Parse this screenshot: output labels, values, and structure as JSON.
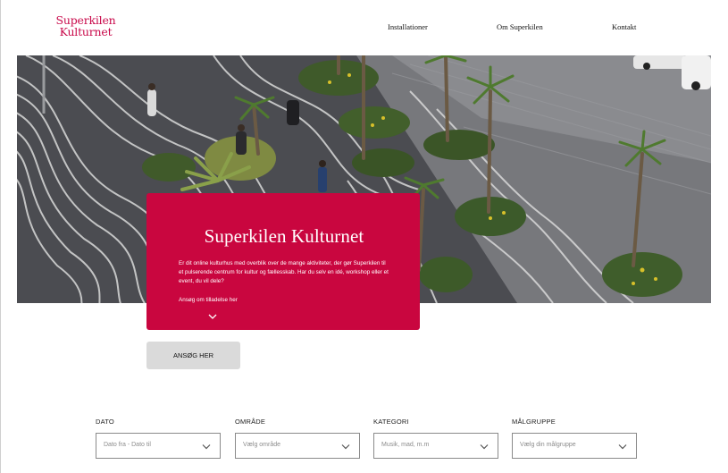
{
  "header": {
    "logo_line1": "Superkilen",
    "logo_line2": "Kulturnet",
    "nav": [
      {
        "label": "Installationer"
      },
      {
        "label": "Om Superkilen"
      },
      {
        "label": "Kontakt"
      }
    ]
  },
  "hero": {
    "image_subject": "aerial-photo-superkilen-plaza-with-palm-trees",
    "title": "Superkilen Kulturnet",
    "text": "Er dit online kulturhus med overblik over de mange aktiviteter, der gør Superkilen til et pulserende centrum for kultur og fællesskab. Har du selv en idé, workshop eller et event, du vil dele?",
    "link_label": "Ansøg om tilladelse her",
    "chevron_icon": "chevron-down-icon"
  },
  "apply_button": {
    "label": "ANSØG HER"
  },
  "filters": [
    {
      "label": "DATO",
      "placeholder": "Dato fra - Dato til"
    },
    {
      "label": "OMRÅDE",
      "placeholder": "Vælg område"
    },
    {
      "label": "KATEGORI",
      "placeholder": "Musik, mad, m.m"
    },
    {
      "label": "MÅLGRUPPE",
      "placeholder": "Vælg din målgruppe"
    }
  ],
  "colors": {
    "brand": "#c9063f",
    "button_bg": "#dadada",
    "pavement": "#4a4b50"
  }
}
